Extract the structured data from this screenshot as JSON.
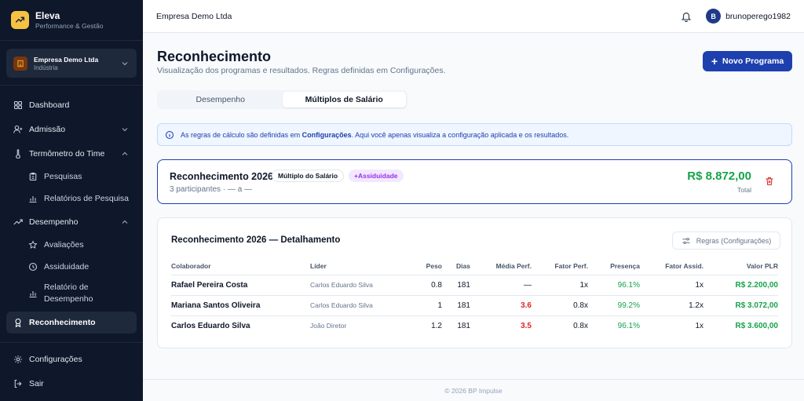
{
  "brand": {
    "name": "Eleva",
    "subtitle": "Performance & Gestão"
  },
  "company": {
    "name": "Empresa Demo Ltda",
    "sector": "Indústria"
  },
  "sidebar": {
    "items": [
      {
        "label": "Dashboard",
        "icon": "grid-icon"
      },
      {
        "label": "Admissão",
        "icon": "user-plus-icon"
      },
      {
        "label": "Termômetro do Time",
        "icon": "thermometer-icon"
      },
      {
        "label": "Pesquisas",
        "icon": "clipboard-icon"
      },
      {
        "label": "Relatórios de Pesquisa",
        "icon": "bar-chart-icon"
      },
      {
        "label": "Desempenho",
        "icon": "trend-icon"
      },
      {
        "label": "Avaliações",
        "icon": "star-icon"
      },
      {
        "label": "Assiduidade",
        "icon": "clock-icon"
      },
      {
        "label": "Relatório de Desempenho",
        "icon": "bar-chart-icon"
      },
      {
        "label": "Reconhecimento",
        "icon": "award-icon"
      },
      {
        "label": "Configurações",
        "icon": "gear-icon"
      },
      {
        "label": "Sair",
        "icon": "logout-icon"
      }
    ]
  },
  "topbar": {
    "title": "Empresa Demo Ltda",
    "avatar_initial": "B",
    "username": "bruno​perego1982"
  },
  "page": {
    "title": "Reconhecimento",
    "subtitle": "Visualização dos programas e resultados. Regras definidas em Configurações.",
    "new_button": "Novo Programa"
  },
  "tabs": [
    {
      "label": "Desempenho"
    },
    {
      "label": "Múltiplos de Salário"
    }
  ],
  "info": {
    "prefix": "As regras de cálculo são definidas em ",
    "link": "Configurações",
    "suffix": ". Aqui você apenas visualiza a configuração aplicada e os resultados."
  },
  "program": {
    "title": "Reconhecimento 2026",
    "badge_type": "Múltiplo do Salário",
    "badge_extra": "+Assiduidade",
    "meta": "3 participantes · — a —",
    "total": "R$ 8.872,00",
    "total_label": "Total"
  },
  "detail": {
    "title": "Reconhecimento 2026 — Detalhamento",
    "rules_button": "Regras (Configurações)",
    "columns": [
      "Colaborador",
      "Líder",
      "Peso",
      "Dias",
      "Média Perf.",
      "Fator Perf.",
      "Presença",
      "Fator Assid.",
      "Valor PLR"
    ],
    "rows": [
      {
        "colaborador": "Rafael Pereira Costa",
        "lider": "Carlos Eduardo Silva",
        "peso": "0.8",
        "dias": "181",
        "media": "—",
        "fator_perf": "1x",
        "presenca": "96.1%",
        "fator_assid": "1x",
        "valor": "R$ 2.200,00"
      },
      {
        "colaborador": "Mariana Santos Oliveira",
        "lider": "Carlos Eduardo Silva",
        "peso": "1",
        "dias": "181",
        "media": "3.6",
        "fator_perf": "0.8x",
        "presenca": "99.2%",
        "fator_assid": "1.2x",
        "valor": "R$ 3.072,00"
      },
      {
        "colaborador": "Carlos Eduardo Silva",
        "lider": "João Diretor",
        "peso": "1.2",
        "dias": "181",
        "media": "3.5",
        "fator_perf": "0.8x",
        "presenca": "96.1%",
        "fator_assid": "1x",
        "valor": "R$ 3.600,00"
      }
    ]
  },
  "footer": "© 2026 BP Impulse",
  "colors": {
    "primary": "#1e40af",
    "success": "#16a34a",
    "danger": "#dc2626",
    "sidebar": "#0f172a"
  }
}
